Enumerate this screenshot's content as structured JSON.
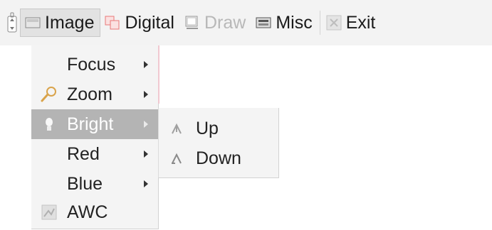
{
  "menubar": {
    "items": [
      {
        "label": "Image",
        "icon": "image-icon",
        "state": "active"
      },
      {
        "label": "Digital",
        "icon": "digital-icon",
        "state": "normal"
      },
      {
        "label": "Draw",
        "icon": "draw-icon",
        "state": "disabled"
      },
      {
        "label": "Misc",
        "icon": "misc-icon",
        "state": "normal"
      },
      {
        "label": "Exit",
        "icon": "exit-icon",
        "state": "normal"
      }
    ]
  },
  "dropdown": {
    "items": [
      {
        "label": "Focus",
        "icon": "",
        "has_submenu": true
      },
      {
        "label": "Zoom",
        "icon": "magnifier-icon",
        "has_submenu": true
      },
      {
        "label": "Bright",
        "icon": "bulb-icon",
        "has_submenu": true,
        "highlighted": true
      },
      {
        "label": "Red",
        "icon": "",
        "has_submenu": true
      },
      {
        "label": "Blue",
        "icon": "",
        "has_submenu": true
      },
      {
        "label": "AWC",
        "icon": "awc-icon",
        "has_submenu": false
      }
    ]
  },
  "submenu": {
    "items": [
      {
        "label": "Up",
        "icon": "up-icon"
      },
      {
        "label": "Down",
        "icon": "down-icon"
      }
    ]
  },
  "colors": {
    "menubar_bg": "#f3f3f3",
    "highlight_bg": "#b4b4b4",
    "disabled_text": "#b8b8b8",
    "digital_icon": "#e87878",
    "zoom_icon": "#d9a34a"
  }
}
